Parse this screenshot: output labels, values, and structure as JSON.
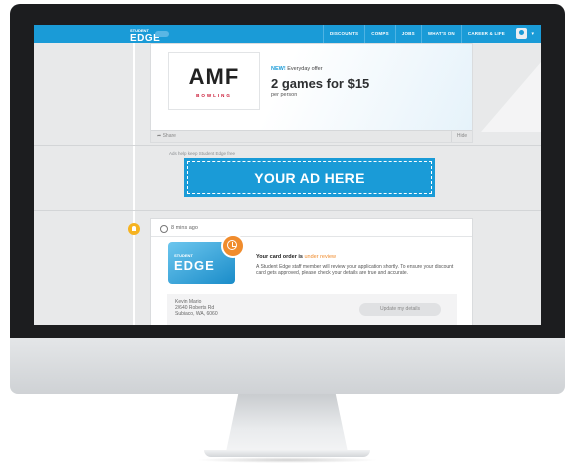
{
  "topbar": {
    "logo_small": "STUDENT",
    "logo": "EDGE",
    "nav": [
      "DISCOUNTS",
      "COMPS",
      "JOBS",
      "WHAT'S ON",
      "CAREER & LIFE"
    ],
    "user_caret": "▾"
  },
  "offer_card": {
    "brand": "AMF",
    "brand_sub": "BOWLING",
    "tag_new": "NEW!",
    "tag_text": "Everyday offer",
    "headline": "2 games for $15",
    "subline": "per person",
    "share": "Share",
    "hide": "Hide",
    "share_icon": "share-arrow-icon"
  },
  "ad": {
    "caption": "Ads help keep Student Edge free",
    "text": "YOUR AD HERE"
  },
  "order_card": {
    "time": "8 mins ago",
    "card_small": "STUDENT",
    "card_big": "EDGE",
    "title": "Your card order is",
    "status": "under review",
    "body": "A Student Edge staff member will review your application shortly. To ensure your discount card gets approved, please check your details are true and accurate.",
    "address": [
      "Kevin Mario",
      "2/640 Roberts Rd",
      "Subiaco, WA, 6060"
    ],
    "update_button": "Update my details"
  },
  "colors": {
    "brand_blue": "#1a9bd7",
    "accent_orange": "#f08c2d",
    "bell_yellow": "#f6b321"
  }
}
